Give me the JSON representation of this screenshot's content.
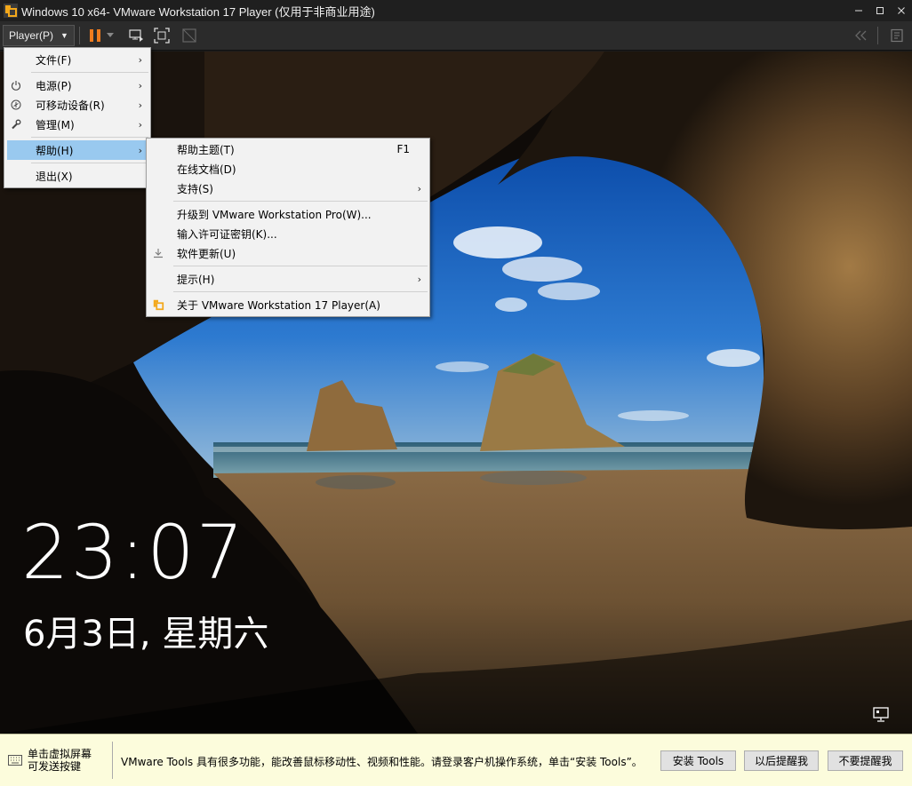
{
  "window": {
    "title": "Windows 10 x64- VMware Workstation 17 Player (仅用于非商业用途)",
    "minimize_icon": "minimize-icon",
    "maximize_icon": "maximize-icon",
    "close_icon": "close-icon"
  },
  "toolbar": {
    "player_label": "Player(P)",
    "icons": [
      "pause-icon",
      "send-ctrl-alt-del-icon",
      "fullscreen-icon",
      "unity-icon",
      "collapse-icon",
      "library-icon"
    ],
    "accent_color": "#f07c1e"
  },
  "player_menu": {
    "items": [
      {
        "label": "文件(F)",
        "icon": "",
        "submenu": true
      },
      {
        "label": "电源(P)",
        "icon": "power-icon",
        "submenu": true
      },
      {
        "label": "可移动设备(R)",
        "icon": "removable-devices-icon",
        "submenu": true
      },
      {
        "label": "管理(M)",
        "icon": "wrench-icon",
        "submenu": true
      },
      {
        "label": "帮助(H)",
        "icon": "",
        "submenu": true,
        "highlighted": true
      },
      {
        "label": "退出(X)",
        "icon": "",
        "submenu": false
      }
    ]
  },
  "help_menu": {
    "items": [
      {
        "label": "帮助主题(T)",
        "shortcut": "F1"
      },
      {
        "label": "在线文档(D)"
      },
      {
        "label": "支持(S)",
        "submenu": true
      },
      {
        "label": "升级到 VMware Workstation Pro(W)..."
      },
      {
        "label": "输入许可证密钥(K)..."
      },
      {
        "label": "软件更新(U)",
        "icon": "download-icon"
      },
      {
        "label": "提示(H)",
        "submenu": true
      },
      {
        "label": "关于 VMware Workstation 17 Player(A)",
        "icon": "vmware-logo-icon"
      }
    ],
    "highlight_color": "#99c9ef"
  },
  "lock_screen": {
    "time": "23:07",
    "date": "6月3日, 星期六",
    "network_icon": "network-icon"
  },
  "notification": {
    "keyboard_hint_line1": "单击虚拟屏幕",
    "keyboard_hint_line2": "可发送按键",
    "message": "VMware Tools 具有很多功能，能改善鼠标移动性、视频和性能。请登录客户机操作系统，单击“安装 Tools”。",
    "install_button": "安装 Tools",
    "remind_later_button": "以后提醒我",
    "never_remind_button": "不要提醒我",
    "background_color": "#fcfcdc"
  }
}
